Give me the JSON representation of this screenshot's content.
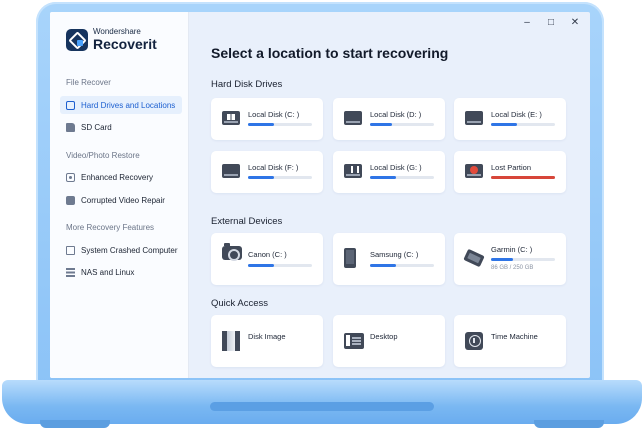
{
  "app": {
    "brand_small": "Wondershare",
    "brand_name": "Recoverit"
  },
  "window_controls": {
    "minimize": "–",
    "maximize": "□",
    "close": "✕"
  },
  "sidebar": {
    "sections": [
      {
        "title": "File Recover",
        "items": [
          {
            "label": "Hard Drives and Locations",
            "icon": "hard-drive-icon",
            "active": true
          },
          {
            "label": "SD Card",
            "icon": "sd-card-icon",
            "active": false
          }
        ]
      },
      {
        "title": "Video/Photo Restore",
        "items": [
          {
            "label": "Enhanced Recovery",
            "icon": "enhanced-recovery-icon",
            "active": false
          },
          {
            "label": "Corrupted Video Repair",
            "icon": "video-repair-icon",
            "active": false
          }
        ]
      },
      {
        "title": "More Recovery Features",
        "items": [
          {
            "label": "System Crashed Computer",
            "icon": "computer-icon",
            "active": false
          },
          {
            "label": "NAS and Linux",
            "icon": "nas-icon",
            "active": false
          }
        ]
      }
    ]
  },
  "main": {
    "title": "Select a location to start recovering",
    "hard_disk_drives": {
      "title": "Hard Disk Drives",
      "items": [
        {
          "label": "Local Disk (C: )",
          "usage": 0.4,
          "icon": "windows-drive-icon"
        },
        {
          "label": "Local Disk (D: )",
          "usage": 0.35,
          "icon": "drive-icon"
        },
        {
          "label": "Local Disk (E: )",
          "usage": 0.4,
          "icon": "drive-icon"
        },
        {
          "label": "Local Disk (F: )",
          "usage": 0.4,
          "icon": "drive-icon"
        },
        {
          "label": "Local Disk (G: )",
          "usage": 0.4,
          "icon": "usb-drive-icon"
        },
        {
          "label": "Lost Partion",
          "usage": 1.0,
          "icon": "lost-partition-icon"
        }
      ]
    },
    "external_devices": {
      "title": "External Devices",
      "items": [
        {
          "label": "Canon (C: )",
          "usage": 0.4,
          "icon": "camera-icon"
        },
        {
          "label": "Samsung (C: )",
          "usage": 0.4,
          "icon": "phone-icon"
        },
        {
          "label": "Garmin (C: )",
          "usage": 0.34,
          "size": "86 GB / 250 GB",
          "icon": "gps-device-icon"
        }
      ]
    },
    "quick_access": {
      "title": "Quick Access",
      "items": [
        {
          "label": "Disk Image",
          "icon": "disk-image-icon"
        },
        {
          "label": "Desktop",
          "icon": "desktop-icon"
        },
        {
          "label": "Time Machine",
          "icon": "time-machine-icon"
        }
      ]
    }
  },
  "colors": {
    "accent": "#2f75e6",
    "danger": "#d7463a",
    "laptop": "#8cc3f7"
  }
}
